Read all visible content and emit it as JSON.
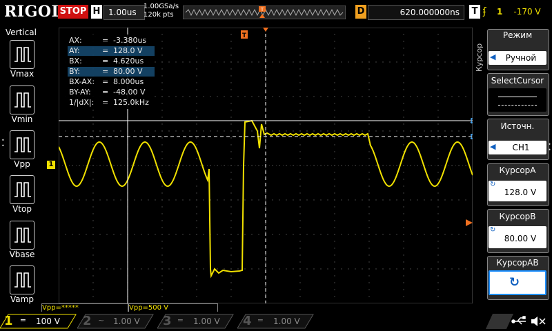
{
  "brand": "RIGOL",
  "run_state": "STOP",
  "horizontal": {
    "label": "H",
    "scale": "1.00us",
    "sample_rate": "1.00GSa/s",
    "memory_depth": "120k pts"
  },
  "delay": {
    "label": "D",
    "value": "620.000000ns"
  },
  "trigger": {
    "label": "T",
    "slope_icon": "rising-edge-icon",
    "source_marker": "1",
    "level": "-170 V"
  },
  "left_menu": {
    "title": "Vertical",
    "items": [
      {
        "label": "Vmax",
        "icon": "vmax-icon"
      },
      {
        "label": "Vmin",
        "icon": "vmin-icon"
      },
      {
        "label": "Vpp",
        "icon": "vpp-icon"
      },
      {
        "label": "Vtop",
        "icon": "vtop-icon"
      },
      {
        "label": "Vbase",
        "icon": "vbase-icon"
      },
      {
        "label": "Vamp",
        "icon": "vamp-icon"
      }
    ]
  },
  "cursor_readout": [
    {
      "key": "AX:",
      "eq": "=",
      "val": "-3.380us",
      "highlight": false
    },
    {
      "key": "AY:",
      "eq": "=",
      "val": "128.0 V",
      "highlight": true
    },
    {
      "key": "BX:",
      "eq": "=",
      "val": "4.620us",
      "highlight": false
    },
    {
      "key": "BY:",
      "eq": "=",
      "val": "80.00 V",
      "highlight": true
    },
    {
      "key": "BX-AX:",
      "eq": "=",
      "val": "8.000us",
      "highlight": false
    },
    {
      "key": "BY-AY:",
      "eq": "=",
      "val": "-48.00 V",
      "highlight": false
    },
    {
      "key": "1/|dX|:",
      "eq": "=",
      "val": "125.0kHz",
      "highlight": false
    }
  ],
  "channel_marker": "1",
  "right_menu": {
    "side_label": "Курсор",
    "mode_title": "Режим",
    "mode_value": "Ручной",
    "select_cursor_title": "SelectCursor",
    "source_title": "Источн.",
    "source_value": "CH1",
    "cursor_a_title": "КурсорA",
    "cursor_a_value": "128.0 V",
    "cursor_b_title": "КурсорB",
    "cursor_b_value": "80.00 V",
    "cursor_ab_title": "КурсорAB"
  },
  "measurements": {
    "m1": "Vpp=*****",
    "m2": "Vpp=500 V"
  },
  "channels": [
    {
      "num": "1",
      "coupling": "═",
      "scale": "100 V",
      "color": "#f0e000",
      "active": true
    },
    {
      "num": "2",
      "coupling": "~",
      "scale": "1.00 V",
      "color": "#00c8ff",
      "active": false
    },
    {
      "num": "3",
      "coupling": "═",
      "scale": "1.00 V",
      "color": "#ff40ff",
      "active": false
    },
    {
      "num": "4",
      "coupling": "═",
      "scale": "1.00 V",
      "color": "#3070ff",
      "active": false
    }
  ],
  "status_icons": [
    "usb-icon",
    "speaker-mute-icon"
  ],
  "colors": {
    "ch1": "#f0e000",
    "accent": "#d01010",
    "highlight": "#15466a"
  }
}
